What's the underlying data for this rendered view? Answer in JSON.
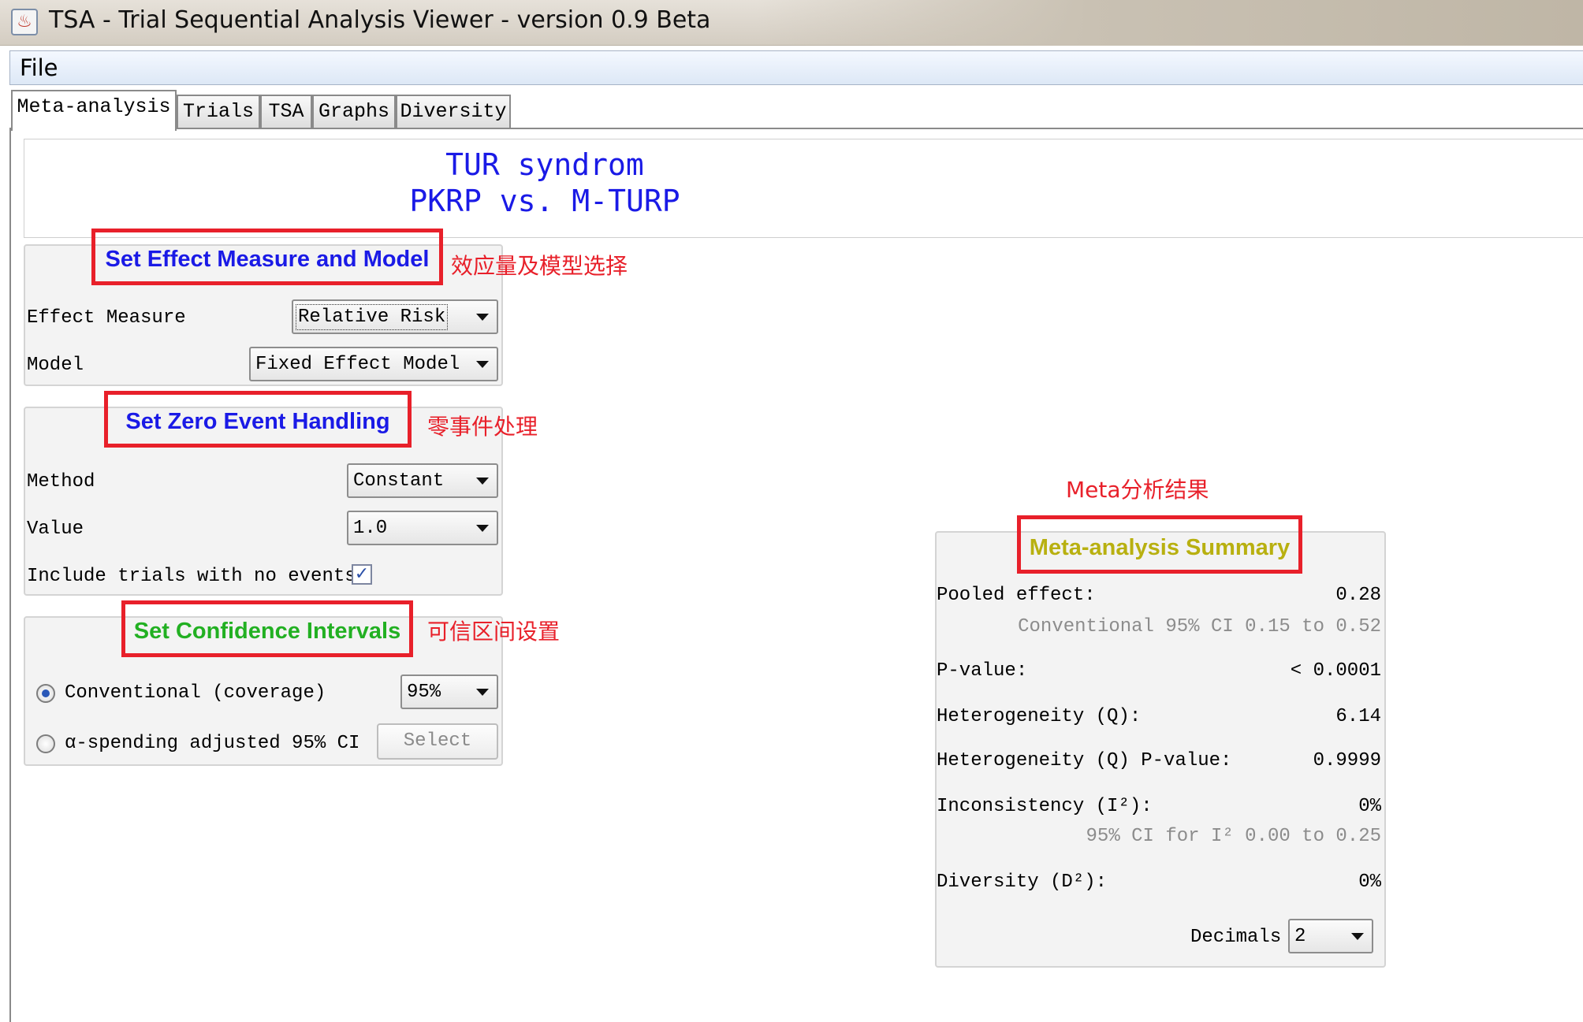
{
  "window": {
    "title": "TSA - Trial Sequential Analysis Viewer - version 0.9 Beta",
    "icon": "java-cup-icon"
  },
  "menu": {
    "file": "File"
  },
  "tabs": [
    {
      "label": "Meta-analysis",
      "active": true
    },
    {
      "label": "Trials",
      "active": false
    },
    {
      "label": "TSA",
      "active": false
    },
    {
      "label": "Graphs",
      "active": false
    },
    {
      "label": "Diversity",
      "active": false
    }
  ],
  "header": {
    "line1": "TUR syndrom",
    "line2": "PKRP vs. M-TURP",
    "color": "#1a1ae6"
  },
  "effect_panel": {
    "title": "Set Effect Measure and Model",
    "note": "效应量及模型选择",
    "effect_measure_label": "Effect Measure",
    "effect_measure_value": "Relative Risk",
    "model_label": "Model",
    "model_value": "Fixed Effect Model"
  },
  "zero_panel": {
    "title": "Set Zero Event Handling",
    "note": "零事件处理",
    "method_label": "Method",
    "method_value": "Constant",
    "value_label": "Value",
    "value_value": "1.0",
    "include_label": "Include trials with no events",
    "include_checked": true
  },
  "ci_panel": {
    "title": "Set Confidence Intervals",
    "note": "可信区间设置",
    "conventional_label": "Conventional (coverage)",
    "conventional_value": "95%",
    "alpha_label": "α-spending adjusted 95% CI",
    "select_button": "Select"
  },
  "summary": {
    "note": "Meta分析结果",
    "title": "Meta-analysis Summary",
    "pooled_label": "Pooled effect:",
    "pooled_value": "0.28",
    "pooled_ci": "Conventional 95% CI 0.15 to 0.52",
    "pvalue_label": "P-value:",
    "pvalue_value": "< 0.0001",
    "het_label": "Heterogeneity (Q):",
    "het_value": "6.14",
    "het_p_label": "Heterogeneity (Q) P-value:",
    "het_p_value": "0.9999",
    "incon_label": "Inconsistency (I²):",
    "incon_value": "0%",
    "incon_ci": "95% CI for I² 0.00 to 0.25",
    "div_label": "Diversity (D²):",
    "div_value": "0%",
    "decimals_label": "Decimals",
    "decimals_value": "2"
  },
  "colors": {
    "annotation_red": "#e8202a",
    "title_blue": "#1a1ae6",
    "title_green": "#22b022",
    "title_olive": "#b8b010"
  }
}
